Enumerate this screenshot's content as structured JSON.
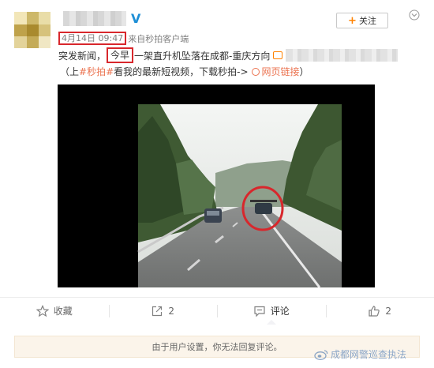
{
  "post": {
    "v_badge": "V",
    "follow_label": "关注",
    "follow_plus": "+",
    "time": "4月14日 09:47",
    "source_prefix": "来自",
    "source_name": "秒拍客户端",
    "text_before": "突发新闻，",
    "text_highlight": "今早",
    "text_after": "一架直升机坠落在成都-重庆方向",
    "line2_open": "（上",
    "hashtag": "#秒拍#",
    "line2_middle": "看我的最新短视频，下载秒拍->",
    "web_link": "网页链接",
    "line2_close": "）"
  },
  "actions": [
    {
      "label": "收藏",
      "icon": "star-icon"
    },
    {
      "label": "2",
      "icon": "share-icon"
    },
    {
      "label": "评论",
      "icon": "comment-icon"
    },
    {
      "label": "2",
      "icon": "thumbs-up-icon"
    }
  ],
  "notice": "由于用户设置，你无法回复评论。",
  "watermark": "成都网警巡查执法",
  "colors": {
    "highlight_box": "#d8272c",
    "link": "#eb7350",
    "accent": "#ff8200",
    "verified": "#1e8fd6"
  }
}
